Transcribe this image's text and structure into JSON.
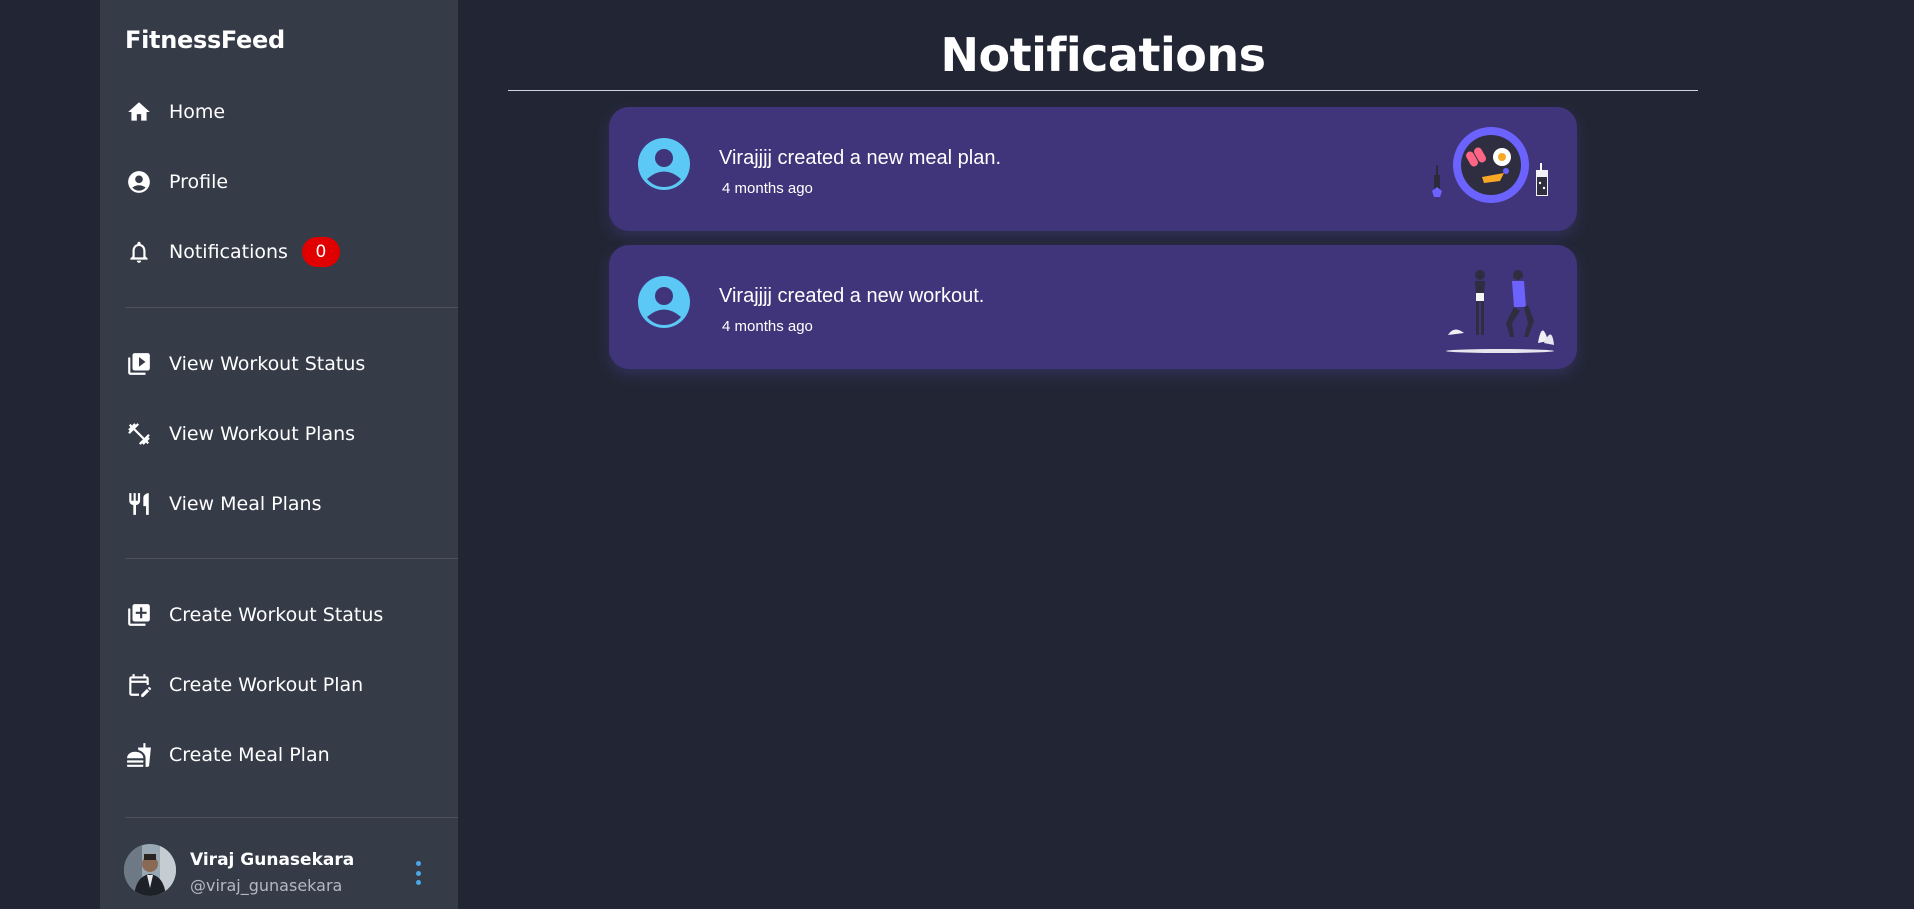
{
  "app": {
    "title": "FitnessFeed"
  },
  "sidebar": {
    "items": [
      {
        "label": "Home",
        "icon": "home-icon"
      },
      {
        "label": "Profile",
        "icon": "account-circle-icon"
      },
      {
        "label": "Notifications",
        "icon": "bell-icon",
        "badge": "0"
      },
      {
        "label": "View Workout Status",
        "icon": "video-library-icon"
      },
      {
        "label": "View Workout Plans",
        "icon": "dumbbell-icon"
      },
      {
        "label": "View Meal Plans",
        "icon": "fork-knife-icon"
      },
      {
        "label": "Create Workout Status",
        "icon": "add-box-icon"
      },
      {
        "label": "Create Workout Plan",
        "icon": "calendar-edit-icon"
      },
      {
        "label": "Create Meal Plan",
        "icon": "fastfood-icon"
      }
    ],
    "user": {
      "name": "Viraj Gunasekara",
      "handle": "@viraj_gunasekara"
    }
  },
  "main": {
    "title": "Notifications",
    "notifications": [
      {
        "text": "Virajjjj created a new meal plan.",
        "time": "4 months ago",
        "illustration": "meal-plate-illustration"
      },
      {
        "text": "Virajjjj created a new workout.",
        "time": "4 months ago",
        "illustration": "workout-people-illustration"
      }
    ]
  },
  "colors": {
    "background": "#222634",
    "sidebar": "#363b48",
    "card": "#40357a",
    "badge": "#e10000",
    "avatar": "#5bc8f5",
    "accent": "#4aa8e8"
  }
}
